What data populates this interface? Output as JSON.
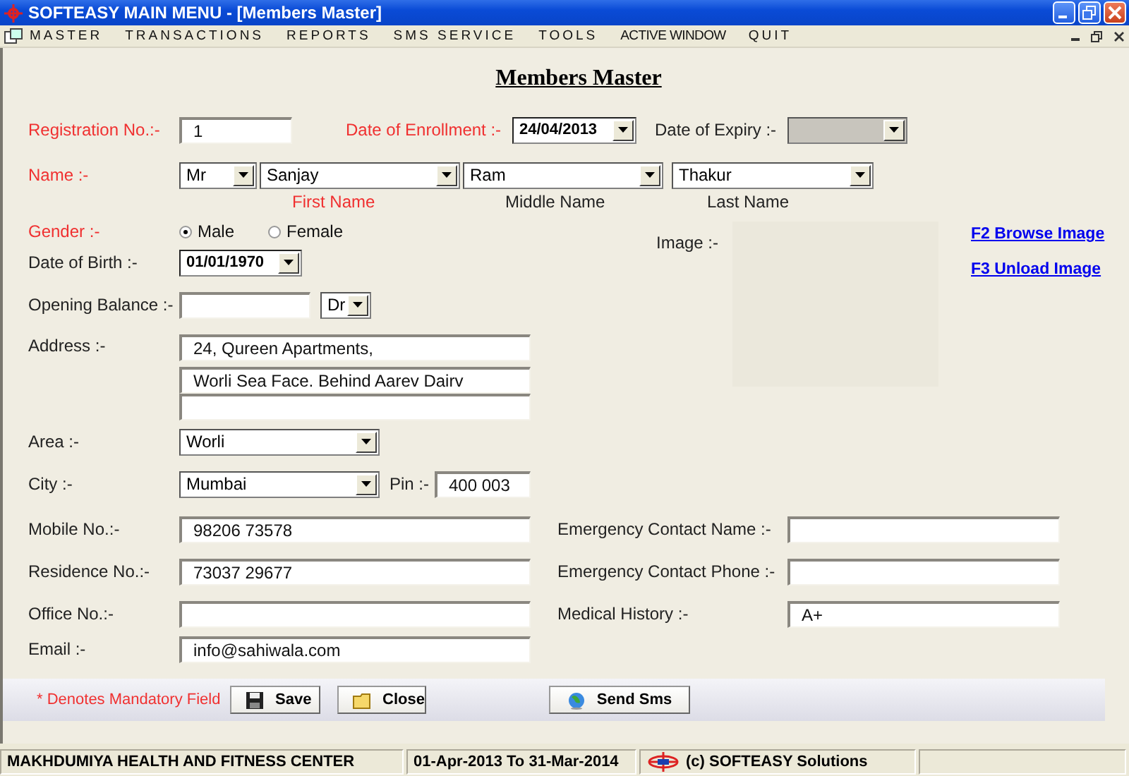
{
  "window": {
    "title": "SOFTEASY MAIN MENU - [Members Master]"
  },
  "menu": [
    {
      "label": "MASTER",
      "spaced": true
    },
    {
      "label": "TRANSACTIONS",
      "spaced": true
    },
    {
      "label": "REPORTS",
      "spaced": true
    },
    {
      "label": "SMS SERVICE",
      "spaced": true
    },
    {
      "label": "TOOLS",
      "spaced": true
    },
    {
      "label": "ACTIVE WINDOW",
      "spaced": false
    },
    {
      "label": "QUIT",
      "spaced": true
    }
  ],
  "form": {
    "title": "Members Master",
    "registration_no": {
      "label": "Registration No.:-",
      "required": true,
      "value": "1"
    },
    "date_of_enrollment": {
      "label": "Date of Enrollment :-",
      "required": true,
      "value": "24/04/2013"
    },
    "date_of_expiry": {
      "label": "Date of Expiry :-",
      "required": false,
      "disabled": true
    },
    "name": {
      "label": "Name :-",
      "required": true,
      "title": "Mr",
      "first": "Sanjay",
      "middle": "Ram",
      "last": "Thakur"
    },
    "name_captions": [
      {
        "text": "First Name",
        "required": true
      },
      {
        "text": "Middle Name",
        "required": false
      },
      {
        "text": "Last Name",
        "required": false
      }
    ],
    "gender": {
      "label": "Gender :-",
      "required": true,
      "options": [
        {
          "label": "Male",
          "selected": true
        },
        {
          "label": "Female",
          "selected": false
        }
      ]
    },
    "date_of_birth": {
      "label": "Date of Birth :-",
      "required": false,
      "value": "01/01/1970"
    },
    "opening_balance": {
      "label": "Opening Balance :-",
      "required": false,
      "type": "Dr"
    },
    "address": {
      "label": "Address :-",
      "required": false,
      "lines": [
        "24, Qureen Apartments,",
        "Worli Sea Face. Behind Aarev Dairv"
      ]
    },
    "area": {
      "label": "Area :-",
      "required": false,
      "value": "Worli"
    },
    "city": {
      "label": "City :-",
      "required": false,
      "value": "Mumbai"
    },
    "pin": {
      "label": "Pin :-",
      "required": false,
      "value": "400 003"
    },
    "image": {
      "label": "Image :-",
      "required": false,
      "links": [
        "F2 Browse Image",
        "F3 Unload Image"
      ]
    },
    "contacts": [
      {
        "label": "Mobile No.:-",
        "required": false,
        "value": "98206 73578",
        "right_label": "Emergency Contact Name :-"
      },
      {
        "label": "Residence No.:-",
        "required": false,
        "value": "73037 29677",
        "right_label": "Emergency Contact Phone :-"
      },
      {
        "label": "Office No.:-",
        "required": false,
        "right_label": "Medical History :-",
        "right_value": "A+"
      },
      {
        "label": "Email :-",
        "required": false,
        "value": "info@sahiwala.com"
      }
    ]
  },
  "footer": {
    "note": "* Denotes Mandatory Field",
    "buttons": [
      {
        "label": "Save",
        "kind": "save"
      },
      {
        "label": "Close",
        "kind": "close"
      },
      {
        "label": "Send Sms",
        "kind": "sms"
      }
    ]
  },
  "status_bar": [
    {
      "text": "MAKHDUMIYA HEALTH AND FITNESS CENTER",
      "kind": "text"
    },
    {
      "text": "01-Apr-2013 To 31-Mar-2014",
      "kind": "text"
    },
    {
      "text": "(c) SOFTEASY Solutions",
      "kind": "logo"
    }
  ]
}
